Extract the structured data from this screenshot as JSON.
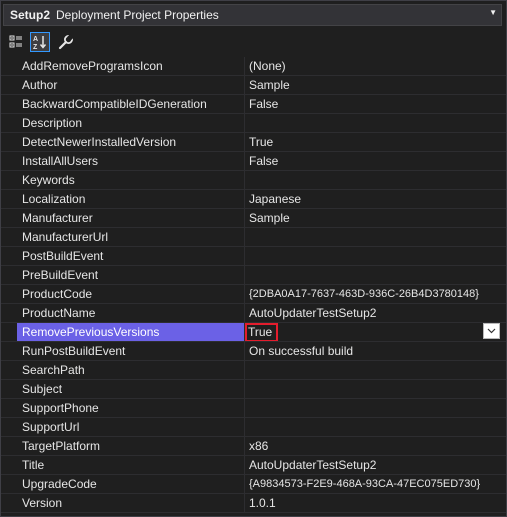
{
  "header": {
    "object_name": "Setup2",
    "object_type": "Deployment Project Properties"
  },
  "toolbar": {
    "buttons": [
      {
        "icon": "categorized-icon",
        "active": false
      },
      {
        "icon": "alphabetical-sort-icon",
        "active": true
      },
      {
        "icon": "property-pages-wrench-icon",
        "active": false
      }
    ]
  },
  "selected_property": "RemovePreviousVersions",
  "properties": [
    {
      "name": "AddRemoveProgramsIcon",
      "value": "(None)"
    },
    {
      "name": "Author",
      "value": "Sample"
    },
    {
      "name": "BackwardCompatibleIDGeneration",
      "value": "False"
    },
    {
      "name": "Description",
      "value": ""
    },
    {
      "name": "DetectNewerInstalledVersion",
      "value": "True"
    },
    {
      "name": "InstallAllUsers",
      "value": "False"
    },
    {
      "name": "Keywords",
      "value": ""
    },
    {
      "name": "Localization",
      "value": "Japanese"
    },
    {
      "name": "Manufacturer",
      "value": "Sample"
    },
    {
      "name": "ManufacturerUrl",
      "value": ""
    },
    {
      "name": "PostBuildEvent",
      "value": ""
    },
    {
      "name": "PreBuildEvent",
      "value": ""
    },
    {
      "name": "ProductCode",
      "value": "{2DBA0A17-7637-463D-936C-26B4D3780148}"
    },
    {
      "name": "ProductName",
      "value": "AutoUpdaterTestSetup2"
    },
    {
      "name": "RemovePreviousVersions",
      "value": "True"
    },
    {
      "name": "RunPostBuildEvent",
      "value": "On successful build"
    },
    {
      "name": "SearchPath",
      "value": ""
    },
    {
      "name": "Subject",
      "value": ""
    },
    {
      "name": "SupportPhone",
      "value": ""
    },
    {
      "name": "SupportUrl",
      "value": ""
    },
    {
      "name": "TargetPlatform",
      "value": "x86"
    },
    {
      "name": "Title",
      "value": "AutoUpdaterTestSetup2"
    },
    {
      "name": "UpgradeCode",
      "value": "{A9834573-F2E9-468A-93CA-47EC075ED730}"
    },
    {
      "name": "Version",
      "value": "1.0.1"
    }
  ],
  "colors": {
    "selection": "#6b61e6",
    "highlight_border": "#e41d2d",
    "background": "#1f1f1f"
  }
}
